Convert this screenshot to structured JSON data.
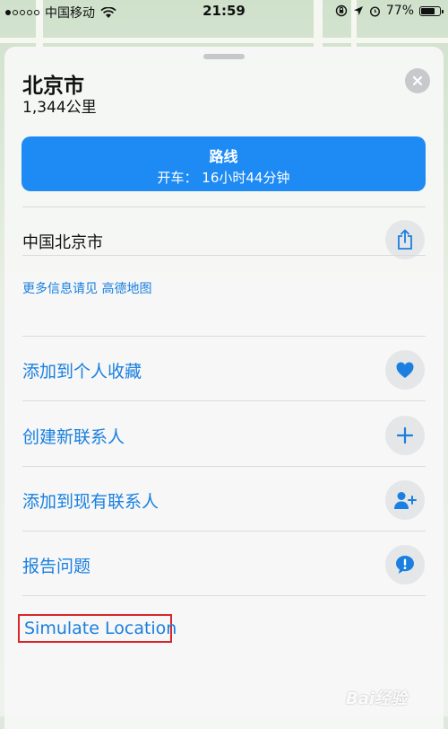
{
  "status_bar": {
    "carrier": "中国移动",
    "time": "21:59",
    "battery_percent": "77%",
    "battery_level": 0.77,
    "signal_dots_filled": 1,
    "signal_dots_total": 5
  },
  "place": {
    "title": "北京市",
    "distance": "1,344公里"
  },
  "route": {
    "title": "路线",
    "drive_time": "开车：  16小时44分钟"
  },
  "address": "中国北京市",
  "more_info": "更多信息请见 高德地图",
  "actions": [
    {
      "label": "添加到个人收藏",
      "icon": "heart-icon"
    },
    {
      "label": "创建新联系人",
      "icon": "plus-icon"
    },
    {
      "label": "添加到现有联系人",
      "icon": "add-contact-icon"
    },
    {
      "label": "报告问题",
      "icon": "report-bubble-icon"
    }
  ],
  "simulate_location": "Simulate Location",
  "watermark": "Bai经验",
  "colors": {
    "accent_blue": "#1e8bf5",
    "link_blue": "#1a7fe0",
    "highlight_red": "#d8262b"
  }
}
